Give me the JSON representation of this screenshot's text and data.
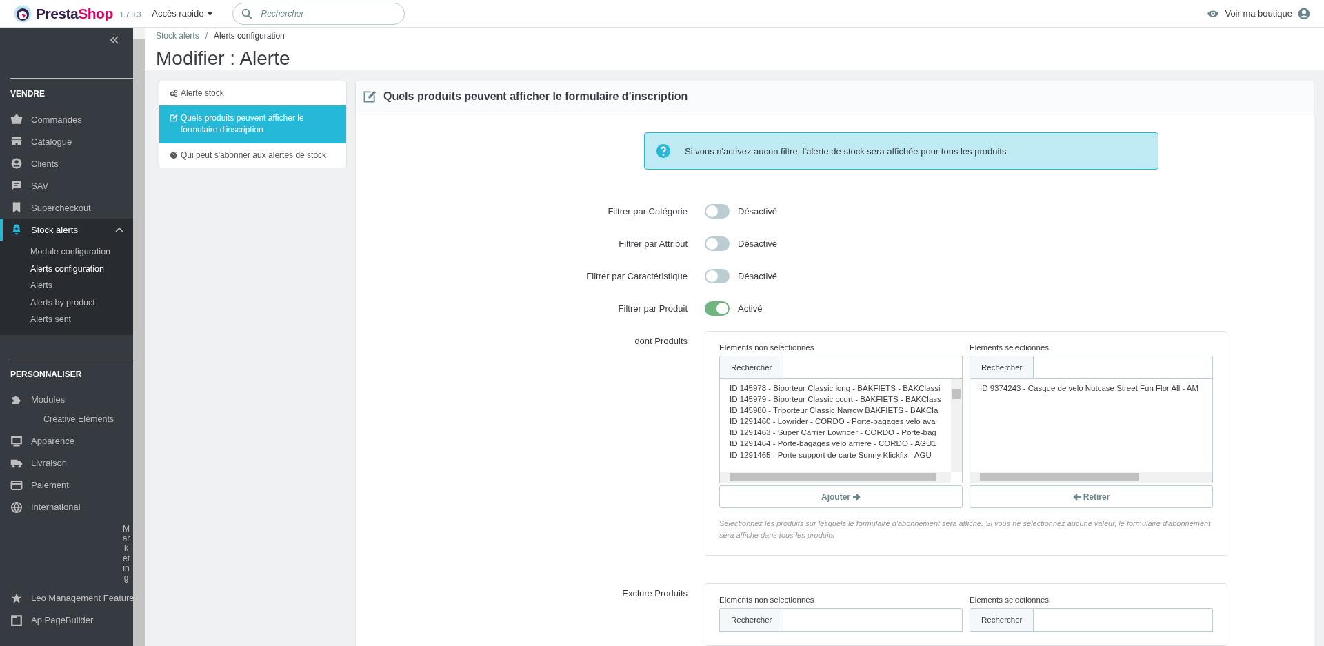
{
  "topbar": {
    "logo_text": "Presta",
    "logo_accent": "Shop",
    "version": "1.7.8.3",
    "quick_access": "Accès rapide",
    "search": {
      "placeholder": "Rechercher"
    },
    "view_shop": "Voir ma boutique"
  },
  "sidebar": {
    "sections": [
      {
        "title": "VENDRE",
        "items": [
          {
            "kind": "link",
            "label": "Commandes"
          },
          {
            "kind": "link",
            "label": "Catalogue"
          },
          {
            "kind": "link",
            "label": "Clients"
          },
          {
            "kind": "link",
            "label": "SAV"
          },
          {
            "kind": "link",
            "label": "Supercheckout"
          },
          {
            "kind": "link",
            "label": "Stock alerts",
            "active": true,
            "expanded": true,
            "children": [
              {
                "label": "Module configuration",
                "selected": false
              },
              {
                "label": "Alerts configuration",
                "selected": true
              },
              {
                "label": "Alerts",
                "selected": false
              },
              {
                "label": "Alerts by product",
                "selected": false
              },
              {
                "label": "Alerts sent",
                "selected": false
              }
            ]
          }
        ]
      },
      {
        "title": "PERSONNALISER",
        "items": [
          {
            "kind": "link",
            "label": "Modules",
            "children": [
              {
                "label": "Creative Elements",
                "selected": false
              }
            ]
          },
          {
            "kind": "link",
            "label": "Apparence"
          },
          {
            "kind": "link",
            "label": "Livraison"
          },
          {
            "kind": "link",
            "label": "Paiement"
          },
          {
            "kind": "link",
            "label": "International"
          },
          {
            "kind": "vertical",
            "label": "Marketing"
          },
          {
            "kind": "link",
            "label": "Leo Management Feature"
          },
          {
            "kind": "link",
            "label": "Ap PageBuilder"
          }
        ]
      }
    ]
  },
  "breadcrumb": {
    "items": [
      "Stock alerts",
      "Alerts configuration"
    ],
    "separator": "/"
  },
  "page_title": "Modifier : Alerte",
  "tabs": [
    {
      "label": "Alerte stock",
      "selected": false
    },
    {
      "label": "Quels produits peuvent afficher le formulaire d'inscription",
      "selected": true
    },
    {
      "label": "Qui peut s'abonner aux alertes de stock",
      "selected": false
    }
  ],
  "panel": {
    "title": "Quels produits peuvent afficher le formulaire d'inscription",
    "info": "Si vous n'activez aucun filtre, l'alerte de stock sera affichée pour tous les produits",
    "filters": [
      {
        "label": "Filtrer par Catégorie",
        "on": false,
        "status": "Désactivé"
      },
      {
        "label": "Filtrer par Attribut",
        "on": false,
        "status": "Désactivé"
      },
      {
        "label": "Filtrer par Caractéristique",
        "on": false,
        "status": "Désactivé"
      },
      {
        "label": "Filtrer par Produit",
        "on": true,
        "status": "Activé"
      }
    ],
    "selectors": [
      {
        "label": "dont Produits",
        "columns": [
          {
            "heading": "Elements non selectionnes",
            "search_button": "Rechercher",
            "items": [
              "ID 145978 - Biporteur Classic long - BAKFIETS - BAKClassi",
              "ID 145979 - Biporteur Classic court - BAKFIETS - BAKClass",
              "ID 145980 - Triporteur Classic Narrow BAKFIETS - BAKCla",
              "ID 1291460 - Lowrider - CORDO - Porte-bagages velo ava",
              "ID 1291463 - Super Carrier Lowrider - CORDO - Porte-bag",
              "ID 1291464 - Porte-bagages velo arriere - CORDO - AGU1",
              "ID 1291465 - Porte support de carte Sunny Klickfix - AGU"
            ],
            "action": "Ajouter"
          },
          {
            "heading": "Elements selectionnes",
            "search_button": "Rechercher",
            "items": [
              "ID 9374243 - Casque de velo Nutcase Street Fun Flor All - AM"
            ],
            "action": "Retirer"
          }
        ],
        "help": "Selectionnez les produits sur lesquels le formulaire d'abonnement sera affiche. Si vous ne selectionnez aucune valeur, le formulaire d'abonnement sera affiche dans tous les produits"
      },
      {
        "label": "Exclure Produits",
        "columns": [
          {
            "heading": "Elements non selectionnes",
            "search_button": "Rechercher"
          },
          {
            "heading": "Elements selectionnes",
            "search_button": "Rechercher"
          }
        ]
      }
    ]
  }
}
